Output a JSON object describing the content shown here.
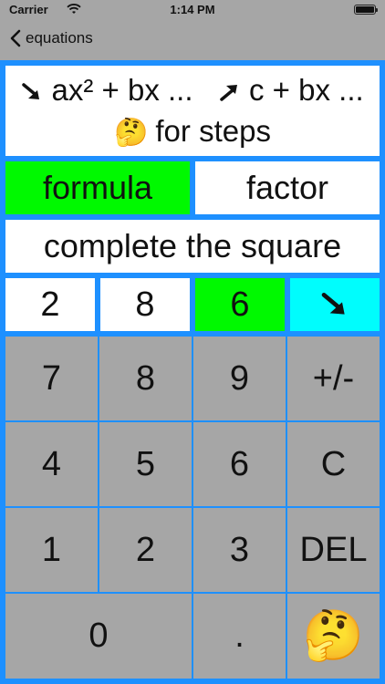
{
  "status_bar": {
    "carrier": "Carrier",
    "time": "1:14 PM"
  },
  "nav": {
    "back_label": "equations"
  },
  "equation": {
    "left_part": "ax² + bx ...",
    "right_part": "c + bx ...",
    "hint": "for steps"
  },
  "methods": {
    "formula": "formula",
    "factor": "factor",
    "complete_square": "complete the square"
  },
  "inputs": {
    "a": "2",
    "b": "8",
    "c": "6"
  },
  "keypad": {
    "row1": [
      "7",
      "8",
      "9",
      "+/-"
    ],
    "row2": [
      "4",
      "5",
      "6",
      "C"
    ],
    "row3": [
      "1",
      "2",
      "3",
      "DEL"
    ],
    "row4": [
      "0",
      "."
    ]
  },
  "icons": {
    "thinking": "🤔",
    "arrow_down_right": "arrow-down-right-icon",
    "arrow_up_right": "arrow-up-right-icon"
  },
  "colors": {
    "frame": "#1e90ff",
    "selected": "#00f900",
    "direction": "#00fdfd",
    "key": "#a6a6a6"
  }
}
